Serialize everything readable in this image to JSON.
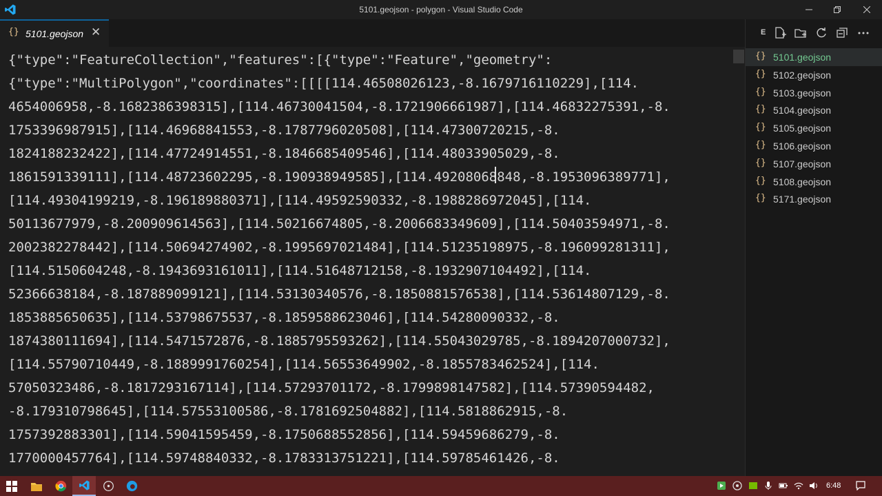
{
  "window": {
    "title": "5101.geojson - polygon - Visual Studio Code"
  },
  "tab": {
    "label": "5101.geojson",
    "icon": "braces-icon"
  },
  "editor": {
    "lines": [
      "{\"type\":\"FeatureCollection\",\"features\":[{\"type\":\"Feature\",\"geometry\":",
      "{\"type\":\"MultiPolygon\",\"coordinates\":[[[[114.46508026123,-8.1679716110229],[114.",
      "4654006958,-8.1682386398315],[114.46730041504,-8.1721906661987],[114.46832275391,-8.",
      "1753396987915],[114.46968841553,-8.1787796020508],[114.47300720215,-8.",
      "1824188232422],[114.47724914551,-8.1846685409546],[114.48033905029,-8.",
      "1861591339111],[114.48723602295,-8.190938949585],[114.49208068848,-8.1953096389771],",
      "[114.49304199219,-8.196189880371],[114.49592590332,-8.1988286972045],[114.",
      "50113677979,-8.200909614563],[114.50216674805,-8.2006683349609],[114.50403594971,-8.",
      "2002382278442],[114.50694274902,-8.1995697021484],[114.51235198975,-8.196099281311],",
      "[114.5150604248,-8.1943693161011],[114.51648712158,-8.1932907104492],[114.",
      "52366638184,-8.187889099121],[114.53130340576,-8.1850881576538],[114.53614807129,-8.",
      "1853885650635],[114.53798675537,-8.1859588623046],[114.54280090332,-8.",
      "1874380111694],[114.5471572876,-8.1885795593262],[114.55043029785,-8.1894207000732],",
      "[114.55790710449,-8.1889991760254],[114.56553649902,-8.1855783462524],[114.",
      "57050323486,-8.1817293167114],[114.57293701172,-8.1799898147582],[114.57390594482,",
      "-8.179310798645],[114.57553100586,-8.1781692504882],[114.5818862915,-8.",
      "1757392883301],[114.59041595459,-8.1750688552856],[114.59459686279,-8.",
      "1770000457764],[114.59748840332,-8.1783313751221],[114.59785461426,-8."
    ]
  },
  "explorer": {
    "title": "E",
    "actions": [
      "new-file-icon",
      "new-folder-icon",
      "refresh-icon",
      "collapse-all-icon",
      "more-icon"
    ],
    "files": [
      {
        "name": "5101.geojson",
        "active": true
      },
      {
        "name": "5102.geojson",
        "active": false
      },
      {
        "name": "5103.geojson",
        "active": false
      },
      {
        "name": "5104.geojson",
        "active": false
      },
      {
        "name": "5105.geojson",
        "active": false
      },
      {
        "name": "5106.geojson",
        "active": false
      },
      {
        "name": "5107.geojson",
        "active": false
      },
      {
        "name": "5108.geojson",
        "active": false
      },
      {
        "name": "5171.geojson",
        "active": false
      }
    ]
  },
  "taskbar": {
    "apps": [
      "windows-start-icon",
      "file-explorer-icon",
      "chrome-icon",
      "vscode-icon",
      "media-icon",
      "edge-icon"
    ],
    "clock": "6:48"
  },
  "colors": {
    "editor_bg": "#1e1e1e",
    "text": "#d4d4d4",
    "accent": "#0e639c",
    "json_icon": "#e2c08d",
    "active_file": "#73c991",
    "taskbar": "#5a1f1f"
  }
}
